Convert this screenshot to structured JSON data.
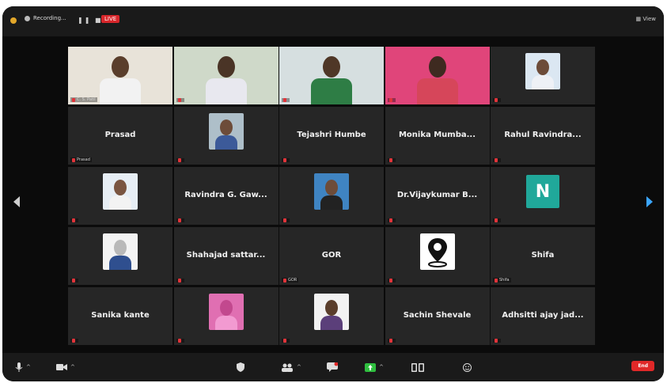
{
  "topbar": {
    "recording_label": "Recording...",
    "live_label": "LIVE",
    "meeting_info": "",
    "view_label": "View"
  },
  "tiles": [
    {
      "kind": "video",
      "name": "",
      "tag": "C. S. Patil",
      "active": true,
      "bg": "#e8e3d9",
      "skin": "#5a3e2c",
      "shirt": "#f2f2f2"
    },
    {
      "kind": "video",
      "name": "",
      "tag": "",
      "active": false,
      "bg": "#cfd9c9",
      "skin": "#4a3426",
      "shirt": "#e8e8ef"
    },
    {
      "kind": "video",
      "name": "",
      "tag": "",
      "active": false,
      "bg": "#d6dfe0",
      "skin": "#4f3727",
      "shirt": "#2e7d45"
    },
    {
      "kind": "video",
      "name": "",
      "tag": "",
      "active": false,
      "bg": "#e0457a",
      "skin": "#3e2a20",
      "shirt": "#d6465a"
    },
    {
      "kind": "photo",
      "name": "",
      "tag": "",
      "photo_bg": "#dbe7f2",
      "skin": "#6d4c39",
      "shirt": "#eef1f6"
    },
    {
      "kind": "name",
      "name": "Prasad",
      "tag": "Prasad"
    },
    {
      "kind": "photo",
      "name": "",
      "tag": "",
      "photo_bg": "#aebfc9",
      "skin": "#6d4c39",
      "shirt": "#3c5a99"
    },
    {
      "kind": "name",
      "name": "Tejashri Humbe",
      "tag": ""
    },
    {
      "kind": "name",
      "name": "Monika Mumba...",
      "tag": ""
    },
    {
      "kind": "name",
      "name": "Rahul Ravindra...",
      "tag": ""
    },
    {
      "kind": "photo",
      "name": "",
      "tag": "",
      "photo_bg": "#e7eef5",
      "skin": "#7a5541",
      "shirt": "#f3f3f3"
    },
    {
      "kind": "name",
      "name": "Ravindra G. Gaw...",
      "tag": ""
    },
    {
      "kind": "photo",
      "name": "",
      "tag": "",
      "photo_bg": "#3f84c2",
      "skin": "#6d4c39",
      "shirt": "#222222"
    },
    {
      "kind": "name",
      "name": "Dr.Vijaykumar B...",
      "tag": ""
    },
    {
      "kind": "letter",
      "name": "",
      "letter": "N",
      "tag": ""
    },
    {
      "kind": "photo",
      "name": "",
      "tag": "",
      "photo_bg": "#f4f4f4",
      "skin": "#b9b9b9",
      "shirt": "#2f4f8f"
    },
    {
      "kind": "name",
      "name": "Shahajad sattar...",
      "tag": ""
    },
    {
      "kind": "name",
      "name": "GOR",
      "tag": "GOR"
    },
    {
      "kind": "pin",
      "name": "",
      "tag": ""
    },
    {
      "kind": "name",
      "name": "Shifa",
      "tag": "Shifa"
    },
    {
      "kind": "name",
      "name": "Sanika kante",
      "tag": ""
    },
    {
      "kind": "photo",
      "name": "",
      "tag": "",
      "photo_bg": "#e06fb2",
      "skin": "#c2488e",
      "shirt": "#f29ad1"
    },
    {
      "kind": "photo",
      "name": "",
      "tag": "",
      "photo_bg": "#f2f2f2",
      "skin": "#5a3e2c",
      "shirt": "#5b3f7a"
    },
    {
      "kind": "name",
      "name": "Sachin Shevale",
      "tag": ""
    },
    {
      "kind": "name",
      "name": "Adhsitti ajay jad...",
      "tag": ""
    }
  ],
  "bottombar": {
    "end_label": "End"
  },
  "colors": {
    "active_speaker": "#9cc13a",
    "live": "#d7262b",
    "end": "#e02828",
    "next_arrow": "#3ba6ff"
  },
  "icons": {
    "audio": "mic-icon",
    "video": "video-camera-icon",
    "security": "shield-icon",
    "participants": "participants-icon",
    "chat": "chat-icon",
    "share": "share-screen-icon",
    "rooms": "breakout-rooms-icon",
    "reactions": "reactions-icon"
  }
}
